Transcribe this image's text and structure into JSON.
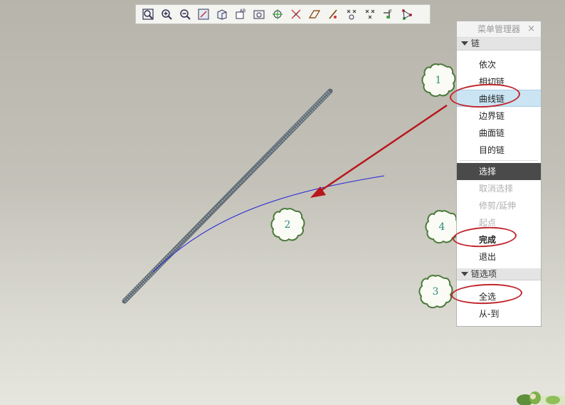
{
  "menu": {
    "title": "菜单管理器",
    "close": "×",
    "section_chain": "链",
    "items_chain": [
      "依次",
      "相切链",
      "曲线链",
      "边界链",
      "曲面链",
      "目的链"
    ],
    "items_action": [
      "选择",
      "取消选择",
      "修剪/延伸",
      "起点",
      "完成",
      "退出"
    ],
    "section_options": "链选项",
    "items_options": [
      "全选",
      "从-到"
    ],
    "highlighted": "曲线链"
  },
  "callouts": [
    "1",
    "2",
    "3",
    "4"
  ],
  "toolbar_icons": [
    "zoom-fit-icon",
    "zoom-in-icon",
    "zoom-out-icon",
    "repaint-icon",
    "shade-icon",
    "named-view-icon",
    "view-manager-icon",
    "spin-center-icon",
    "datum-plane-icon",
    "datum-axis-icon",
    "datum-point-icon",
    "csys-icon",
    "annotation-icon",
    "layer-icon",
    "network-icon"
  ],
  "colors": {
    "highlight": "#cbe4f4",
    "selected_dark": "#4a4a4a",
    "annotation_red": "#c0272d",
    "curve_blue": "#2424d8"
  }
}
